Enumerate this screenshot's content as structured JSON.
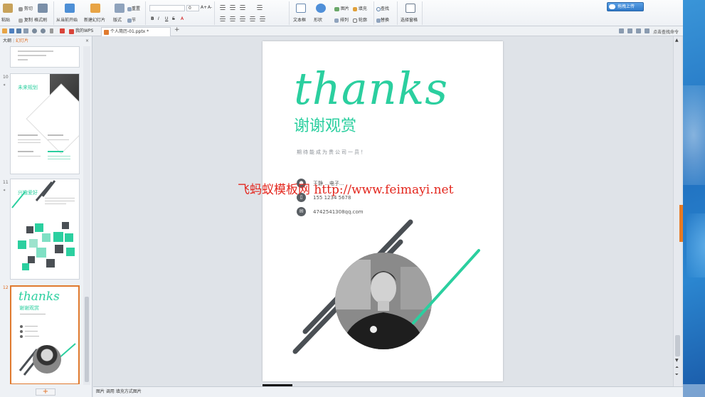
{
  "ribbon": {
    "paste": "粘贴",
    "cut": "剪切",
    "copy": "复制",
    "format_painter": "格式刷",
    "from_current": "从当前开始",
    "new_slide": "新建幻灯片",
    "layout": "版式",
    "reset": "重置",
    "section": "节",
    "font_size_value": "0",
    "bold": "B",
    "italic": "I",
    "underline": "U",
    "strike": "S",
    "font_color": "A",
    "grow": "A+",
    "shrink": "A-",
    "textbox": "文本框",
    "shape": "形状",
    "picture": "图片",
    "fill": "填充",
    "arrange": "排列",
    "outline": "轮廓",
    "find": "查找",
    "replace": "替换",
    "select_pane": "选择窗格",
    "upload": "拖拽上传"
  },
  "tabbar": {
    "tab_mywps": "我的WPS",
    "tab_file": "个人简历-01.pptx *",
    "add": "+",
    "right_text": "点击查找命令"
  },
  "leftpanel": {
    "tab_outline": "大纲",
    "tab_slides": "幻灯片",
    "close": "×",
    "slide10_num": "10",
    "slide10_title": "未来规划",
    "slide11_num": "11",
    "slide11_title": "兴趣爱好",
    "slide12_num": "12",
    "slide12_title": "thanks",
    "slide12_sub": "谢谢观赏",
    "add_slide": "+"
  },
  "slide": {
    "title": "thanks",
    "subtitle": "谢谢观赏",
    "tagline": "期待能成为贵公司一员！",
    "contact_name": "王静   ...电子...",
    "contact_phone": "155  1234  5678",
    "contact_email": "4742541308qq.com"
  },
  "watermark": "飞蚂蚁模板网 http://www.feimayi.net",
  "statusbar": {
    "text": "图片 调用 填充方式图片"
  },
  "colors": {
    "accent": "#2bcf9f",
    "dark_line": "#4a4f54",
    "selection": "#e07a2e"
  }
}
